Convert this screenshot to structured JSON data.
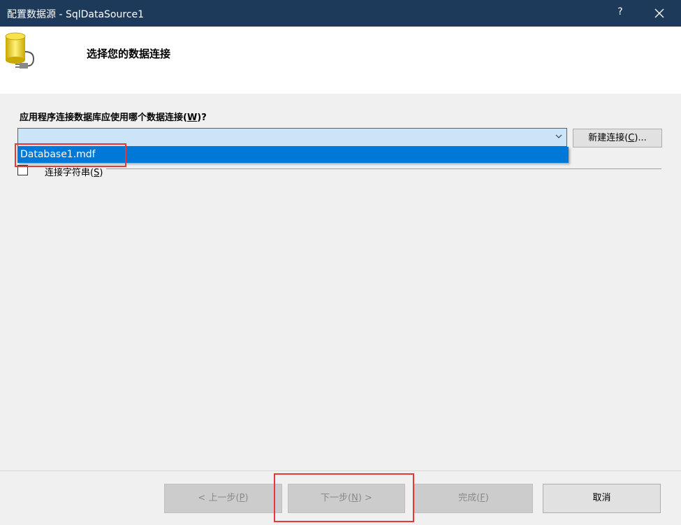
{
  "window": {
    "title": "配置数据源 - SqlDataSource1",
    "help_label": "?"
  },
  "header": {
    "heading": "选择您的数据连接"
  },
  "form": {
    "question_prefix": "应用程序连接数据库应使用哪个数据连接(",
    "question_key": "W",
    "question_suffix": ")?",
    "connection_combo_value": "",
    "new_connection_prefix": "新建连接(",
    "new_connection_key": "C",
    "new_connection_suffix": ")...",
    "dropdown_items": [
      "Database1.mdf"
    ],
    "connection_string_prefix": "连接字符串(",
    "connection_string_key": "S",
    "connection_string_suffix": ")",
    "connection_string_checked": false
  },
  "footer": {
    "back_prefix": "< 上一步(",
    "back_key": "P",
    "back_suffix": ")",
    "next_prefix": "下一步(",
    "next_key": "N",
    "next_suffix": ") >",
    "finish_prefix": "完成(",
    "finish_key": "F",
    "finish_suffix": ")",
    "cancel_label": "取消"
  },
  "colors": {
    "titlebar": "#1e3a5a",
    "selection": "#0078d7",
    "highlight_box": "#e53935"
  }
}
